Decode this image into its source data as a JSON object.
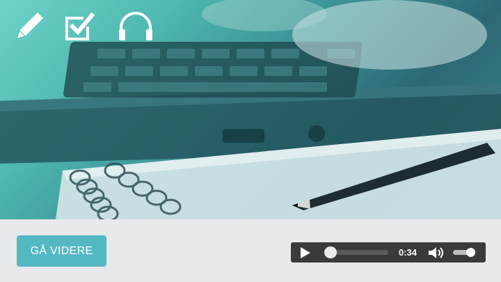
{
  "hero": {
    "image_description_icon_names": [
      "pencil-icon",
      "checkbox-check-icon",
      "headphones-icon"
    ]
  },
  "footer": {
    "continue_label": "GÅ VIDERE"
  },
  "player": {
    "time": "0:34",
    "progress": 0.0,
    "volume": 0.8
  },
  "colors": {
    "accent": "#54b8c3",
    "player_bg": "#3a3a3d",
    "footer_bg": "#e8e9ec"
  }
}
